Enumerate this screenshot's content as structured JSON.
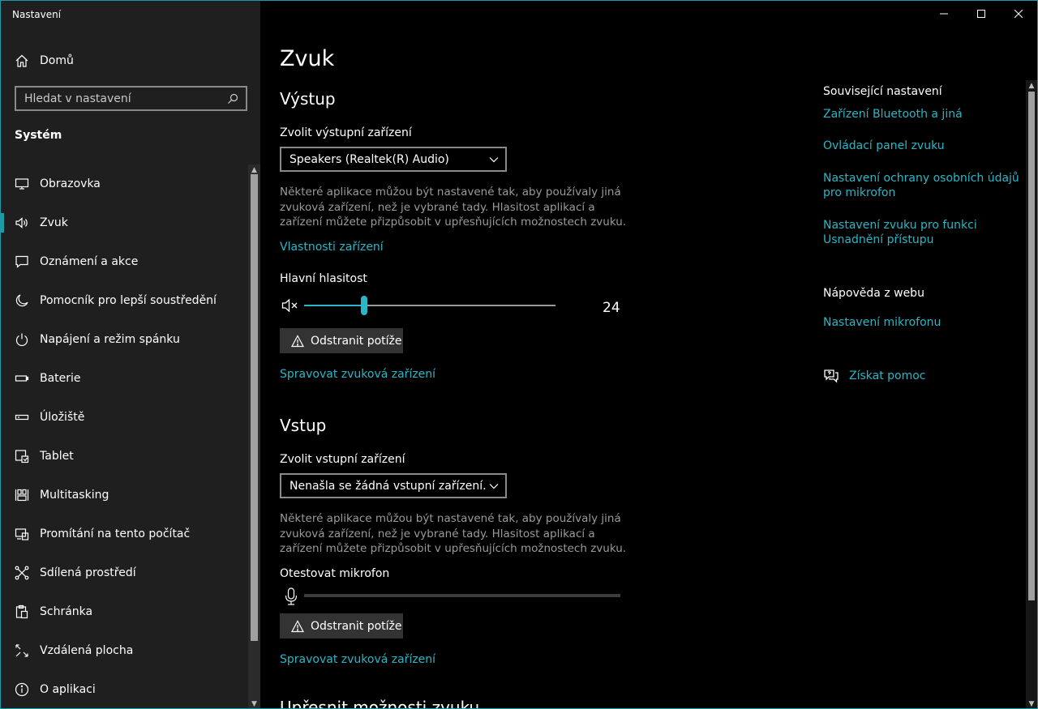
{
  "window": {
    "title": "Nastavení",
    "controls": [
      "minimize-icon",
      "maximize-icon",
      "close-icon"
    ]
  },
  "sidebar": {
    "home_label": "Domů",
    "search_placeholder": "Hledat v nastavení",
    "group_title": "Systém",
    "items": [
      {
        "label": "Obrazovka",
        "icon": "monitor-icon"
      },
      {
        "label": "Zvuk",
        "icon": "speaker-icon",
        "active": true
      },
      {
        "label": "Oznámení a akce",
        "icon": "notification-icon"
      },
      {
        "label": "Pomocník pro lepší soustředění",
        "icon": "moon-icon"
      },
      {
        "label": "Napájení a režim spánku",
        "icon": "power-icon"
      },
      {
        "label": "Baterie",
        "icon": "battery-icon"
      },
      {
        "label": "Úložiště",
        "icon": "storage-icon"
      },
      {
        "label": "Tablet",
        "icon": "tablet-icon"
      },
      {
        "label": "Multitasking",
        "icon": "multitasking-icon"
      },
      {
        "label": "Promítání na tento počítač",
        "icon": "projecting-icon"
      },
      {
        "label": "Sdílená prostředí",
        "icon": "shared-experiences-icon"
      },
      {
        "label": "Schránka",
        "icon": "clipboard-icon"
      },
      {
        "label": "Vzdálená plocha",
        "icon": "remote-desktop-icon"
      },
      {
        "label": "O aplikaci",
        "icon": "info-icon"
      }
    ]
  },
  "main": {
    "page_title": "Zvuk",
    "output": {
      "title": "Výstup",
      "device_label": "Zvolit výstupní zařízení",
      "device_value": "Speakers (Realtek(R) Audio)",
      "description": "Některé aplikace můžou být nastavené tak, aby používaly jiná zvuková zařízení, než je vybrané tady. Hlasitost aplikací a zařízení můžete přizpůsobit v upřesňujících možnostech zvuku.",
      "properties_link": "Vlastnosti zařízení",
      "volume_label": "Hlavní hlasitost",
      "volume_value": "24",
      "volume_percent": 24,
      "troubleshoot_label": "Odstranit potíže",
      "manage_link": "Spravovat zvuková zařízení"
    },
    "input": {
      "title": "Vstup",
      "device_label": "Zvolit vstupní zařízení",
      "device_value": "Nenašla se žádná vstupní zařízení.",
      "description": "Některé aplikace můžou být nastavené tak, aby používaly jiná zvuková zařízení, než je vybrané tady. Hlasitost aplikací a zařízení můžete přizpůsobit v upřesňujících možnostech zvuku.",
      "test_label": "Otestovat mikrofon",
      "troubleshoot_label": "Odstranit potíže",
      "manage_link": "Spravovat zvuková zařízení"
    },
    "advanced_title_partial": "Upřesnit možnosti zvuku"
  },
  "related": {
    "title": "Související nastavení",
    "links": [
      "Zařízení Bluetooth a jiná",
      "Ovládací panel zvuku",
      "Nastavení ochrany osobních údajů pro mikrofon",
      "Nastavení zvuku pro funkci Usnadnění přístupu"
    ],
    "web_help_title": "Nápověda z webu",
    "web_help_links": [
      "Nastavení mikrofonu"
    ],
    "get_help": "Získat pomoc"
  },
  "colors": {
    "accent": "#2ab6c6",
    "border": "#1d9aa8",
    "sidebar_bg": "#1f1f1f",
    "main_bg": "#000000",
    "muted_text": "#9a9a9a"
  }
}
